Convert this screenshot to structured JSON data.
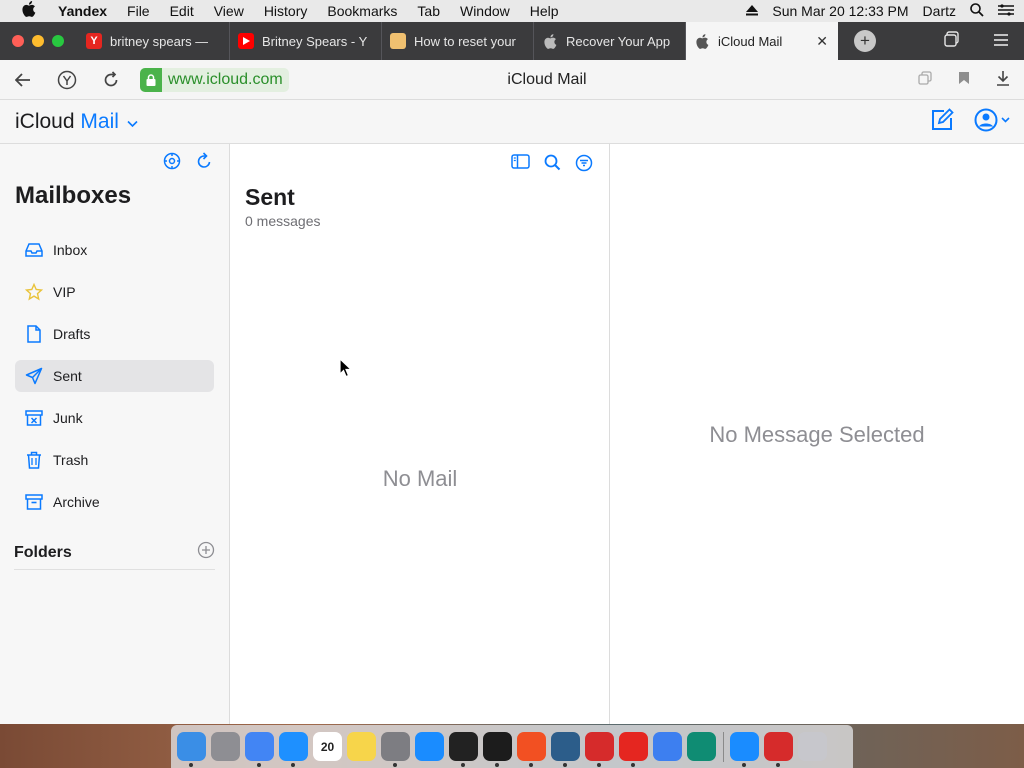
{
  "menubar": {
    "app_name": "Yandex",
    "items": [
      "File",
      "Edit",
      "View",
      "History",
      "Bookmarks",
      "Tab",
      "Window",
      "Help"
    ],
    "clock": "Sun Mar 20  12:33 PM",
    "user": "Dartz"
  },
  "tabs": [
    {
      "label": "britney spears —",
      "favicon": "yandex-favicon",
      "color": "#e52620"
    },
    {
      "label": "Britney Spears - Y",
      "favicon": "youtube-favicon",
      "color": "#ff0000"
    },
    {
      "label": "How to reset your",
      "favicon": "article-favicon",
      "color": "#e0a040"
    },
    {
      "label": "Recover Your App",
      "favicon": "apple-favicon",
      "color": "#aaaaaa"
    },
    {
      "label": "iCloud Mail",
      "favicon": "apple-favicon",
      "color": "#666666",
      "active": true
    }
  ],
  "address": {
    "url": "www.icloud.com",
    "page_title": "iCloud Mail"
  },
  "app": {
    "brand_icloud": "iCloud",
    "brand_mail": "Mail",
    "accent": "#0a7aff"
  },
  "sidebar": {
    "title": "Mailboxes",
    "items": [
      {
        "label": "Inbox",
        "icon": "inbox-icon"
      },
      {
        "label": "VIP",
        "icon": "star-icon"
      },
      {
        "label": "Drafts",
        "icon": "document-icon"
      },
      {
        "label": "Sent",
        "icon": "paperplane-icon",
        "active": true
      },
      {
        "label": "Junk",
        "icon": "junk-icon"
      },
      {
        "label": "Trash",
        "icon": "trash-icon"
      },
      {
        "label": "Archive",
        "icon": "archive-icon"
      }
    ],
    "folders_title": "Folders"
  },
  "message_list": {
    "title": "Sent",
    "count": "0 messages",
    "empty_text": "No Mail"
  },
  "reading_pane": {
    "empty_text": "No Message Selected"
  },
  "dock": {
    "apps": [
      {
        "name": "finder-icon",
        "color": "#3a8ee6"
      },
      {
        "name": "launchpad-icon",
        "color": "#8e8e93"
      },
      {
        "name": "chrome-icon",
        "color": "#4285f4"
      },
      {
        "name": "safari-icon",
        "color": "#1e90ff"
      },
      {
        "name": "calendar-icon",
        "color": "#ffffff",
        "text": "20"
      },
      {
        "name": "notes-icon",
        "color": "#f7d54a"
      },
      {
        "name": "system-preferences-icon",
        "color": "#7d7d82"
      },
      {
        "name": "app-store-icon",
        "color": "#1a8cff"
      },
      {
        "name": "activity-monitor-icon",
        "color": "#222222"
      },
      {
        "name": "terminal-icon",
        "color": "#1c1c1c"
      },
      {
        "name": "microsoft-icon",
        "color": "#f25022"
      },
      {
        "name": "vpn-shield-icon",
        "color": "#2c5d8a"
      },
      {
        "name": "magnet-icon",
        "color": "#d62b2b"
      },
      {
        "name": "yandex-browser-icon",
        "color": "#e52620"
      },
      {
        "name": "cube-icon",
        "color": "#3d7ff0"
      },
      {
        "name": "edge-icon",
        "color": "#0f8c73"
      },
      {
        "name": "app-store-folder-icon",
        "color": "#1a8cff"
      },
      {
        "name": "magnet-folder-icon",
        "color": "#d62b2b"
      },
      {
        "name": "trash-bin-icon",
        "color": "#c7c7cc"
      }
    ]
  }
}
